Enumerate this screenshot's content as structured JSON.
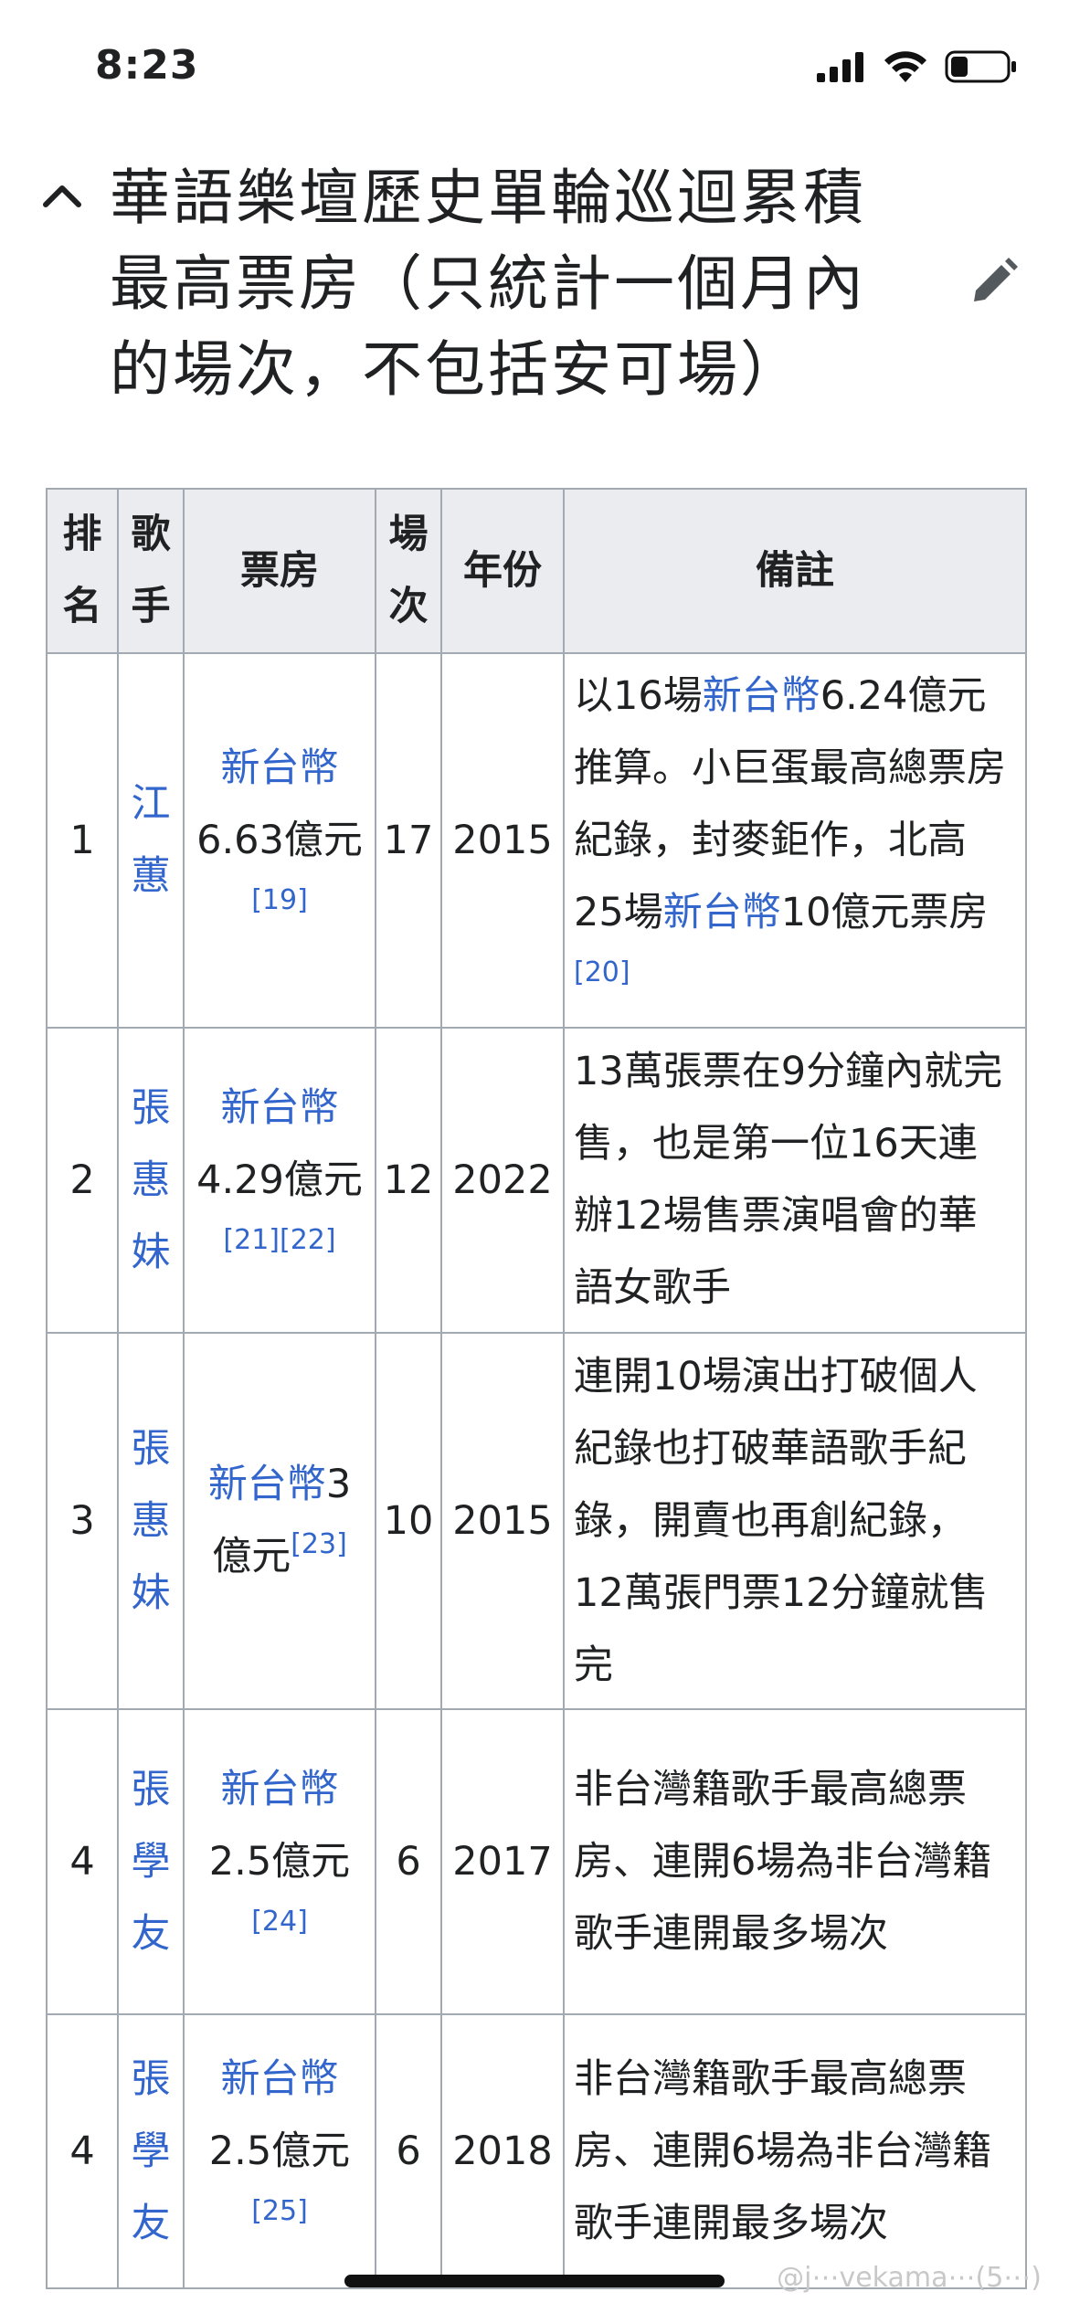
{
  "status": {
    "time": "8:23"
  },
  "heading": {
    "title": "華語樂壇歷史單輪巡迴累積最高票房（只統計一個月內的場次，不包括安可場）"
  },
  "table": {
    "headers": [
      "排名",
      "歌手",
      "票房",
      "場次",
      "年份",
      "備註"
    ],
    "rows": [
      {
        "rank": "1",
        "singer": "江蕙",
        "gross_link": "新台幣",
        "gross_amount": "6.63億元",
        "refs": [
          "[19]"
        ],
        "shows": "17",
        "year": "2015",
        "note": [
          {
            "t": "以16場"
          },
          {
            "t": "新台幣",
            "link": true
          },
          {
            "t": "6.24億元推算。小巨蛋最高總票房紀錄，封麥鉅作，北高25場"
          },
          {
            "t": "新台幣",
            "link": true
          },
          {
            "t": "10億元票房"
          },
          {
            "t": "[20]",
            "ref": true
          }
        ]
      },
      {
        "rank": "2",
        "singer": "張惠妹",
        "gross_link": "新台幣",
        "gross_amount": "4.29億元",
        "refs": [
          "[21]",
          "[22]"
        ],
        "shows": "12",
        "year": "2022",
        "note": [
          {
            "t": "13萬張票在9分鐘內就完售，也是第一位16天連辦12場售票演唱會的華語女歌手"
          }
        ]
      },
      {
        "rank": "3",
        "singer": "張惠妹",
        "gross_link": "新台幣",
        "gross_amount": "3億元",
        "refs": [
          "[23]"
        ],
        "shows": "10",
        "year": "2015",
        "note": [
          {
            "t": "連開10場演出打破個人紀錄也打破華語歌手紀錄，開賣也再創紀錄，12萬張門票12分鐘就售完"
          }
        ]
      },
      {
        "rank": "4",
        "singer": "張學友",
        "gross_link": "新台幣",
        "gross_amount": "2.5億元",
        "refs": [
          "[24]"
        ],
        "shows": "6",
        "year": "2017",
        "note": [
          {
            "t": "非台灣籍歌手最高總票房、連開6場為非台灣籍歌手連開最多場次"
          }
        ]
      },
      {
        "rank": "4",
        "singer": "張學友",
        "gross_link": "新台幣",
        "gross_amount": "2.5億元",
        "refs": [
          "[25]"
        ],
        "shows": "6",
        "year": "2018",
        "note": [
          {
            "t": "非台灣籍歌手最高總票房、連開6場為非台灣籍歌手連開最多場次"
          }
        ]
      }
    ]
  },
  "watermark": "@j⋯vekama⋯(5⋯)"
}
